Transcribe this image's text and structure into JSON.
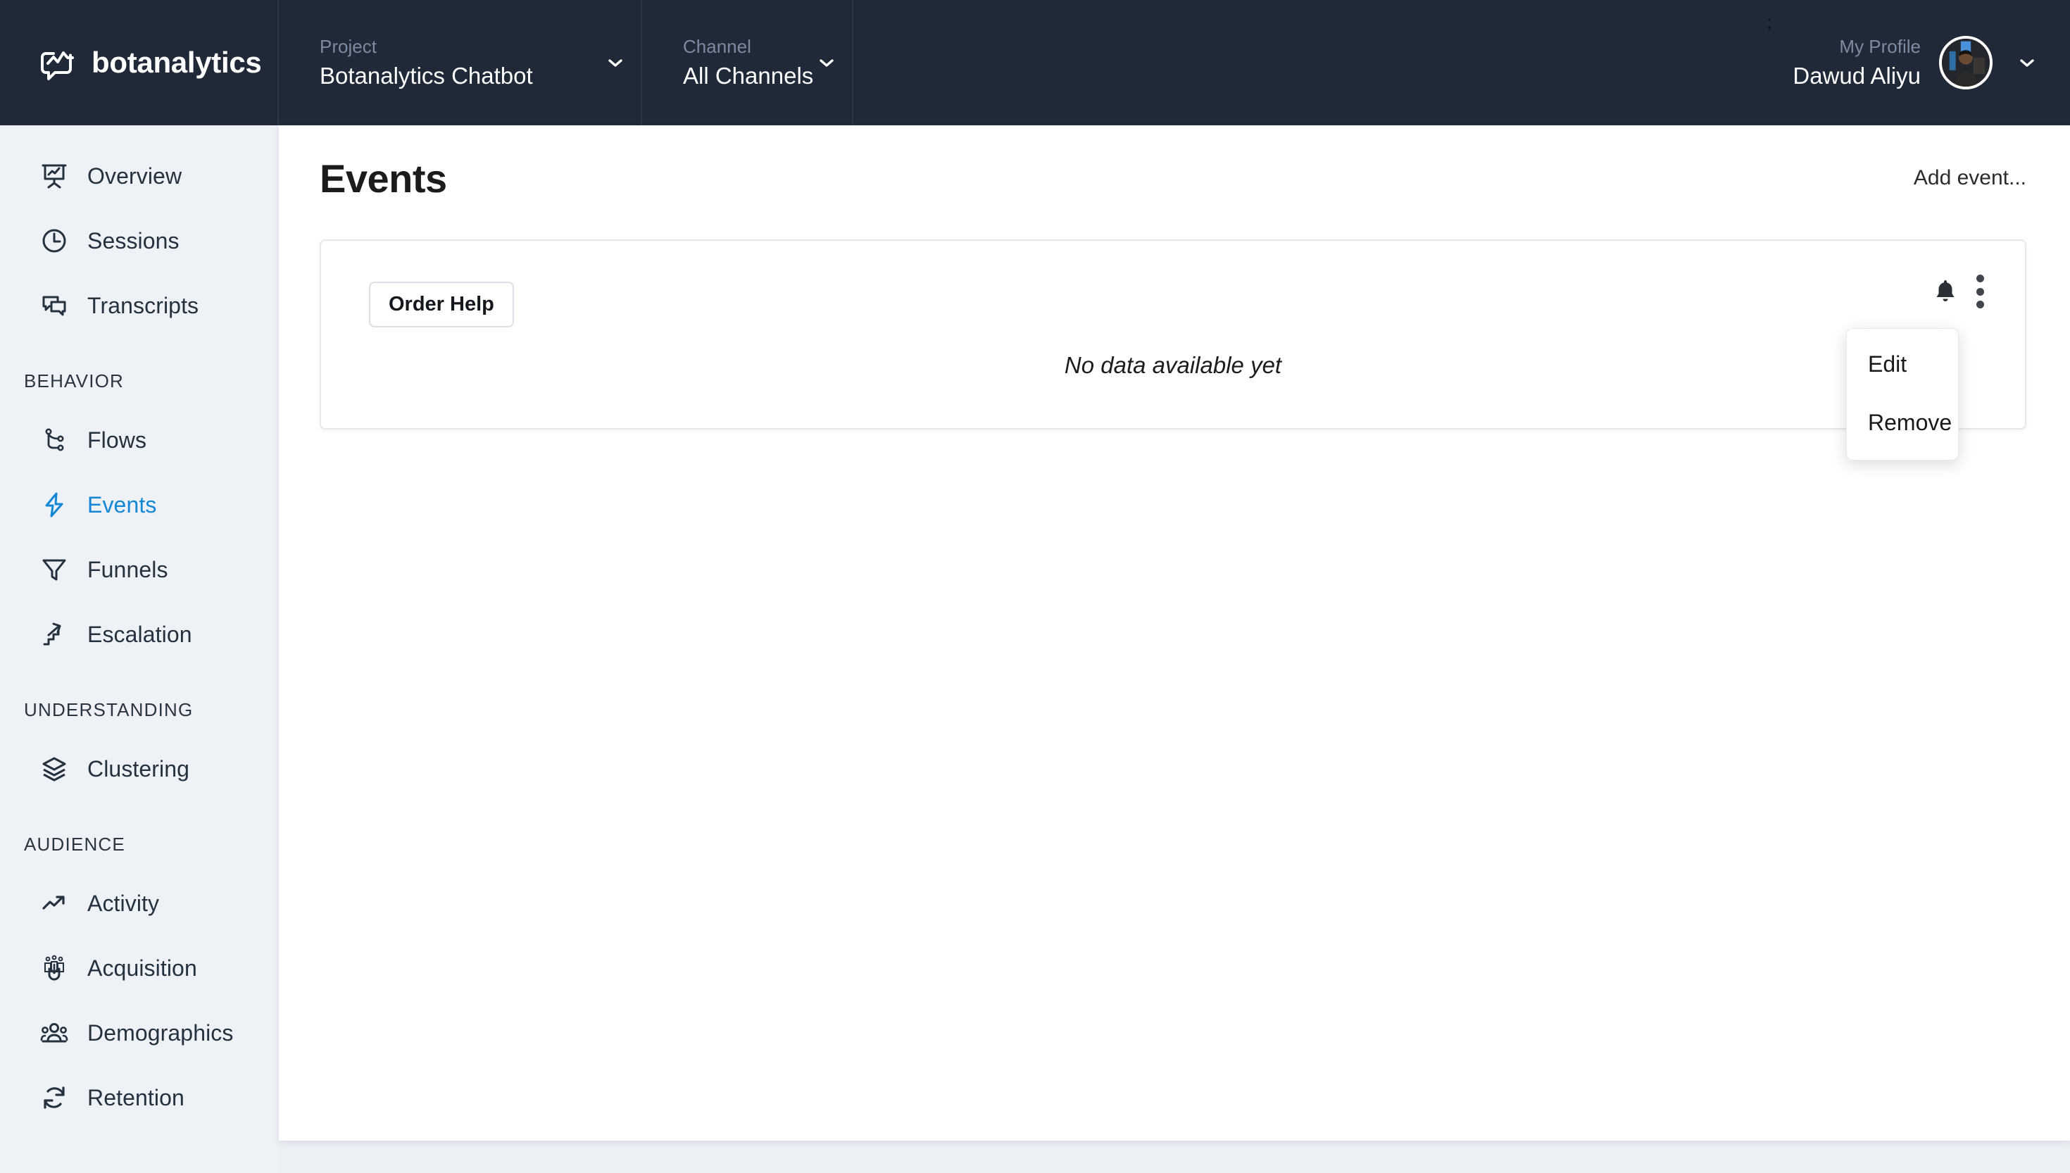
{
  "brand": {
    "name": "botanalytics",
    "logo_icon": "speech-bubble-chart-logo"
  },
  "topbar": {
    "project": {
      "label": "Project",
      "value": "Botanalytics Chatbot",
      "caret_icon": "chevron-down-icon"
    },
    "channel": {
      "label": "Channel",
      "value": "All Channels",
      "caret_icon": "chevron-down-icon"
    },
    "profile": {
      "label": "My Profile",
      "name": "Dawud Aliyu",
      "avatar_icon": "user-avatar-photo",
      "caret_icon": "chevron-down-icon"
    },
    "drag_handle": ";"
  },
  "sidebar": {
    "items": [
      {
        "label": "Overview",
        "icon": "presentation-chart-icon",
        "active": false
      },
      {
        "label": "Sessions",
        "icon": "clock-icon",
        "active": false
      },
      {
        "label": "Transcripts",
        "icon": "chat-bubbles-icon",
        "active": false
      }
    ],
    "groups": [
      {
        "title": "BEHAVIOR",
        "items": [
          {
            "label": "Flows",
            "icon": "flow-branch-icon",
            "active": false
          },
          {
            "label": "Events",
            "icon": "lightning-bolt-icon",
            "active": true
          },
          {
            "label": "Funnels",
            "icon": "funnel-icon",
            "active": false
          },
          {
            "label": "Escalation",
            "icon": "stairs-arrow-icon",
            "active": false
          }
        ]
      },
      {
        "title": "UNDERSTANDING",
        "items": [
          {
            "label": "Clustering",
            "icon": "layers-icon",
            "active": false
          }
        ]
      },
      {
        "title": "AUDIENCE",
        "items": [
          {
            "label": "Activity",
            "icon": "trend-up-arrow-icon",
            "active": false
          },
          {
            "label": "Acquisition",
            "icon": "magnet-people-icon",
            "active": false
          },
          {
            "label": "Demographics",
            "icon": "people-group-icon",
            "active": false
          },
          {
            "label": "Retention",
            "icon": "refresh-cycle-icon",
            "active": false
          }
        ]
      }
    ]
  },
  "main": {
    "title": "Events",
    "add_event_label": "Add event...",
    "card": {
      "chip_label": "Order Help",
      "bell_icon": "bell-icon",
      "kebab_icon": "kebab-menu-icon",
      "empty_message": "No data available yet"
    },
    "context_menu": {
      "visible": true,
      "items": [
        {
          "label": "Edit"
        },
        {
          "label": "Remove"
        }
      ]
    }
  },
  "colors": {
    "header_bg": "#1f2937",
    "sidebar_bg": "#eef2f7",
    "accent": "#1287d4",
    "page_bg": "#edf1f6",
    "text_dark": "#24313f"
  }
}
